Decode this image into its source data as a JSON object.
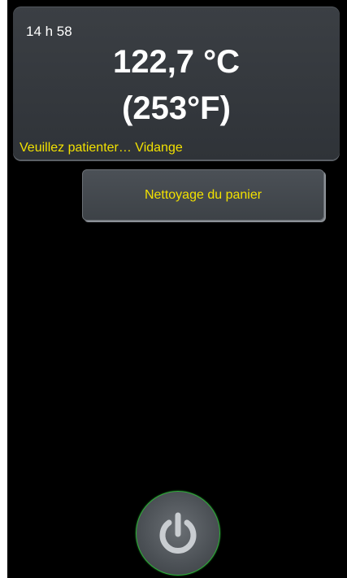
{
  "status": {
    "clock": "14 h 58",
    "temperature_c": "122,7 °C",
    "temperature_f": "(253°F)",
    "message": "Veuillez patienter… Vidange"
  },
  "actions": {
    "clean_basket_label": "Nettoyage du panier"
  },
  "power": {
    "icon": "power-icon"
  },
  "colors": {
    "background": "#000000",
    "panel": "#33373c",
    "accent_text": "#f2e100",
    "power_ring": "#2fae3a"
  }
}
